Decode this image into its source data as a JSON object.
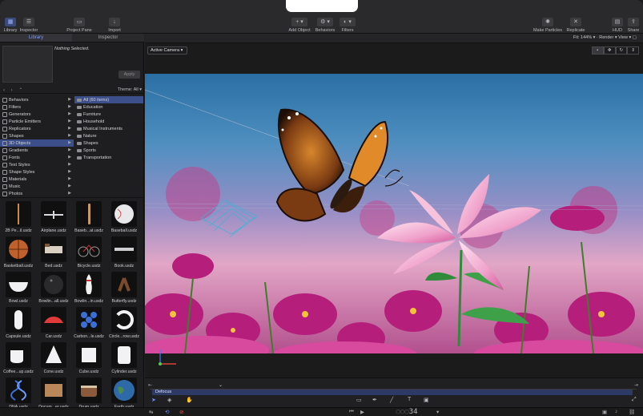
{
  "toolbar": {
    "library_label": "Library",
    "inspector_label": "Inspector",
    "project_pane_label": "Project Pane",
    "import_label": "Import",
    "add_object_label": "Add Object",
    "behaviors_label": "Behaviors",
    "filters_label": "Filters",
    "make_particles_label": "Make Particles",
    "replicate_label": "Replicate",
    "hud_label": "HUD",
    "share_label": "Share"
  },
  "panel": {
    "tab_library": "Library",
    "tab_inspector": "Inspector",
    "nothing_selected": "Nothing Selected.",
    "apply_label": "Apply",
    "theme_label": "Theme: All",
    "categories": [
      "Behaviors",
      "Filters",
      "Generators",
      "Particle Emitters",
      "Replicators",
      "Shapes",
      "3D Objects",
      "Gradients",
      "Fonts",
      "Text Styles",
      "Shape Styles",
      "Materials",
      "Music",
      "Photos"
    ],
    "subcategories": [
      "All (60 items)",
      "Education",
      "Furniture",
      "Household",
      "Musical Instruments",
      "Nature",
      "Shapes",
      "Sports",
      "Transportation"
    ],
    "items": [
      "2B Pe...il.usdz",
      "Airplane.usdz",
      "Baseb...at.usdz",
      "Baseball.usdz",
      "Basketball.usdz",
      "Bed.usdz",
      "Bicycle.usdz",
      "Book.usdz",
      "Bowl.usdz",
      "Bowlin...all.usdz",
      "Bowlin...in.usdz",
      "Butterfly.usdz",
      "Capsule.usdz",
      "Car.usdz",
      "Carbon...le.usdz",
      "Circle...row.usdz",
      "Coffee...up.usdz",
      "Cone.usdz",
      "Cube.usdz",
      "Cylinder.usdz",
      "DNA.usdz",
      "Docum...er.usdz",
      "Drum.usdz",
      "Earth.usdz"
    ]
  },
  "canvas": {
    "fit_label": "Fit: 144%",
    "render_label": "Render",
    "view_label": "View",
    "camera_label": "Active Camera"
  },
  "timeline": {
    "track_label": "Defocus",
    "timecode": "34"
  },
  "colors": {
    "accent": "#3d4f8a",
    "active_tab": "#7f9cff",
    "track": "#2d3a66"
  }
}
